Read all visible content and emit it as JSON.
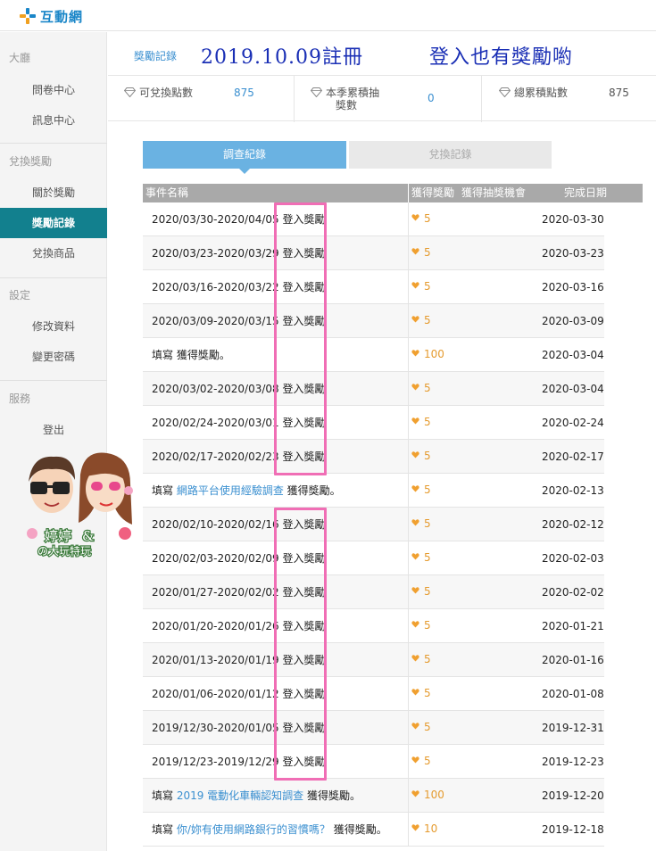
{
  "header": {
    "logo_text": "互動網"
  },
  "sidebar": {
    "sections": [
      {
        "label": "大廳",
        "items": [
          "問卷中心",
          "訊息中心"
        ]
      },
      {
        "label": "兌換獎勵",
        "items": [
          "關於獎勵",
          "獎勵記錄",
          "兌換商品"
        ]
      },
      {
        "label": "設定",
        "items": [
          "修改資料",
          "變更密碼"
        ]
      },
      {
        "label": "服務",
        "items": [
          "登出"
        ]
      }
    ],
    "active_item": "獎勵記錄"
  },
  "main": {
    "reward_link": "獎勵記錄",
    "headline_date": "2019.10.09註冊",
    "headline_note": "登入也有獎勵喲",
    "stats": [
      {
        "label": "可兌換點數",
        "value": "875"
      },
      {
        "label_line1": "本季累積抽",
        "label_line2": "獎數",
        "value": "0"
      },
      {
        "label": "總累積點數",
        "value": "875"
      }
    ],
    "tabs": [
      {
        "label": "調查紀錄",
        "active": true
      },
      {
        "label": "兌換記錄",
        "active": false
      }
    ],
    "table": {
      "headers": [
        "事件名稱",
        "獲得獎勵",
        "獲得抽獎機會",
        "完成日期"
      ],
      "rows": [
        {
          "name": "2020/03/30-2020/04/05 登入獎勵",
          "points": "5",
          "date": "2020-03-30"
        },
        {
          "name": "2020/03/23-2020/03/29 登入獎勵",
          "points": "5",
          "date": "2020-03-23"
        },
        {
          "name": "2020/03/16-2020/03/22 登入獎勵",
          "points": "5",
          "date": "2020-03-16"
        },
        {
          "name": "2020/03/09-2020/03/15 登入獎勵",
          "points": "5",
          "date": "2020-03-09"
        },
        {
          "name": "填寫 獲得獎勵。",
          "points": "100",
          "date": "2020-03-04"
        },
        {
          "name": "2020/03/02-2020/03/08 登入獎勵",
          "points": "5",
          "date": "2020-03-04"
        },
        {
          "name": "2020/02/24-2020/03/01 登入獎勵",
          "points": "5",
          "date": "2020-02-24"
        },
        {
          "name": "2020/02/17-2020/02/23 登入獎勵",
          "points": "5",
          "date": "2020-02-17"
        },
        {
          "prefix": "填寫 ",
          "link": "網路平台使用經驗調查",
          "suffix": " 獲得獎勵。",
          "points": "5",
          "date": "2020-02-13"
        },
        {
          "name": "2020/02/10-2020/02/16 登入獎勵",
          "points": "5",
          "date": "2020-02-12"
        },
        {
          "name": "2020/02/03-2020/02/09 登入獎勵",
          "points": "5",
          "date": "2020-02-03"
        },
        {
          "name": "2020/01/27-2020/02/02 登入獎勵",
          "points": "5",
          "date": "2020-02-02"
        },
        {
          "name": "2020/01/20-2020/01/26 登入獎勵",
          "points": "5",
          "date": "2020-01-21"
        },
        {
          "name": "2020/01/13-2020/01/19 登入獎勵",
          "points": "5",
          "date": "2020-01-16"
        },
        {
          "name": "2020/01/06-2020/01/12 登入獎勵",
          "points": "5",
          "date": "2020-01-08"
        },
        {
          "name": "2019/12/30-2020/01/05 登入獎勵",
          "points": "5",
          "date": "2019-12-31"
        },
        {
          "name": "2019/12/23-2019/12/29 登入獎勵",
          "points": "5",
          "date": "2019-12-23"
        },
        {
          "prefix": "填寫 ",
          "link": "2019 電動化車輛認知調查",
          "suffix": " 獲得獎勵。",
          "points": "100",
          "date": "2019-12-20"
        },
        {
          "prefix": "填寫 ",
          "link": "你/妳有使用網路銀行的習慣嗎？",
          "suffix": " 獲得獎勵。",
          "points": "10",
          "date": "2019-12-18"
        }
      ]
    }
  },
  "colors": {
    "brand_blue": "#1a86c8",
    "sidebar_active": "#12808e",
    "tab_active": "#6ab2e2",
    "points_orange": "#e59b2f",
    "highlight_pink": "#f06eb5",
    "headline_blue": "#1a2fb5"
  },
  "icons": [
    "logo-mark-icon",
    "diamond-icon",
    "heart-icon"
  ]
}
